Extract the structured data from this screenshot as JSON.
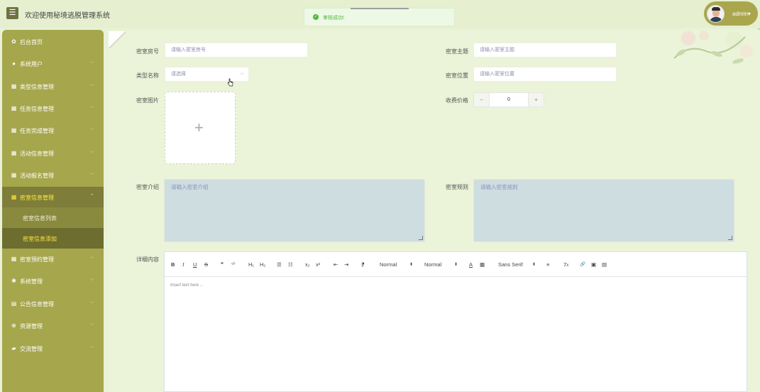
{
  "header": {
    "menu_icon": "hamburger-icon",
    "title": "欢迎使用秘境逃脱管理系统",
    "toast": "审核成功!",
    "user": "admin",
    "user_caret": "▾"
  },
  "sidebar": {
    "items": [
      {
        "label": "后台首页",
        "icon": "home-icon",
        "glyph": "✿",
        "chev": ""
      },
      {
        "label": "系统用户",
        "icon": "user-icon",
        "glyph": "●",
        "chev": "⌵"
      },
      {
        "label": "类型信息管理",
        "icon": "grid-icon",
        "glyph": "▦",
        "chev": "⌵"
      },
      {
        "label": "任务信息管理",
        "icon": "grid-icon",
        "glyph": "▦",
        "chev": "⌵"
      },
      {
        "label": "任务完成管理",
        "icon": "grid-icon",
        "glyph": "▦",
        "chev": "⌵"
      },
      {
        "label": "活动信息管理",
        "icon": "grid-icon",
        "glyph": "▦",
        "chev": "⌵"
      },
      {
        "label": "活动报名管理",
        "icon": "grid-icon",
        "glyph": "▦",
        "chev": "⌵"
      },
      {
        "label": "密室信息管理",
        "icon": "grid-icon",
        "glyph": "▦",
        "chev": "⌃"
      },
      {
        "label": "密室预约管理",
        "icon": "grid-icon",
        "glyph": "▦",
        "chev": "⌵"
      },
      {
        "label": "系统管理",
        "icon": "gear-icon",
        "glyph": "✺",
        "chev": "⌵"
      },
      {
        "label": "公告信息管理",
        "icon": "document-icon",
        "glyph": "▤",
        "chev": "⌵"
      },
      {
        "label": "资源管理",
        "icon": "plus-circle-icon",
        "glyph": "⊕",
        "chev": "⌵"
      },
      {
        "label": "交流管理",
        "icon": "chat-icon",
        "glyph": "▰",
        "chev": "⌵"
      }
    ],
    "sub_items": [
      {
        "label": "密室信息列表"
      },
      {
        "label": "密室信息添加"
      }
    ]
  },
  "form": {
    "room_no_label": "密室房号",
    "room_no_placeholder": "请输入密室房号",
    "theme_label": "密室主题",
    "theme_placeholder": "请输入密室主题",
    "type_label": "类型名称",
    "type_placeholder": "请选择",
    "location_label": "密室位置",
    "location_placeholder": "请输入密室位置",
    "image_label": "密室图片",
    "price_label": "收费价格",
    "price_value": "0",
    "price_minus": "−",
    "price_plus": "+",
    "intro_label": "密室介绍",
    "intro_placeholder": "请输入密室介绍",
    "rules_label": "密室规则",
    "rules_placeholder": "请输入密室规则",
    "detail_label": "详细内容",
    "editor_placeholder": "Insert text here ..."
  },
  "editor_toolbar": {
    "bold": "B",
    "italic": "I",
    "underline": "U",
    "strike": "S",
    "quote": "❞",
    "code": "‹/›",
    "h1": "H₁",
    "h2": "H₂",
    "ordered": "☰",
    "bullet": "☷",
    "sub": "x₂",
    "sup": "x²",
    "outdent": "⇤",
    "indent": "⇥",
    "direction": "⁋",
    "size": "Normal",
    "header": "Normal",
    "color": "A",
    "background": "▦",
    "font": "Sans Serif",
    "align": "≡",
    "clean": "Tx",
    "link": "🔗",
    "image": "▣",
    "video": "▤",
    "dropdown_caret": "⬍"
  },
  "colors": {
    "sidebar_bg": "#a6a64d",
    "active_text": "#ffeb3b",
    "toast_green": "#52b83a",
    "textarea_bg": "#cddde0"
  }
}
